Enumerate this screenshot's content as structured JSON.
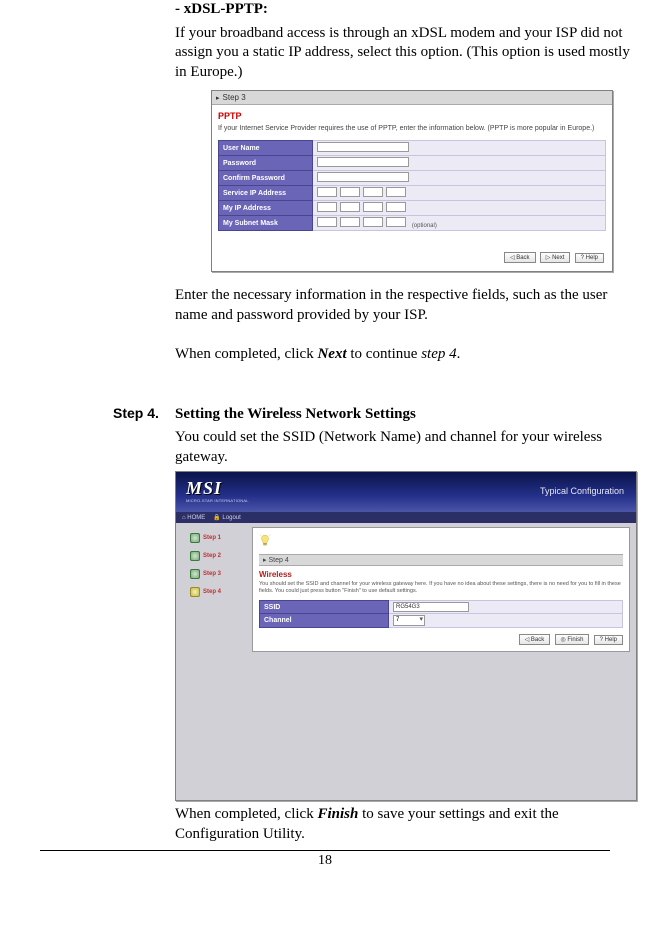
{
  "section1": {
    "title": "- xDSL-PPTP:",
    "desc1": "If your broadband access is through an xDSL modem and your ISP did not assign you a static IP address, select this option. (This option is used mostly in Europe.)",
    "desc2": "Enter the necessary information in the respective fields, such as the user name and password provided by your ISP.",
    "desc3a": "When completed, click ",
    "desc3b": "Next",
    "desc3c": " to continue ",
    "desc3d": "step 4",
    "desc3e": "."
  },
  "shot1": {
    "stepbar": "Step 3",
    "title": "PPTP",
    "desc": "If your Internet Service Provider requires the use of PPTP, enter the information below. (PPTP is more popular in Europe.)",
    "rows": {
      "r1": "User Name",
      "r2": "Password",
      "r3": "Confirm Password",
      "r4": "Service IP Address",
      "r5": "My IP Address",
      "r6": "My Subnet Mask"
    },
    "optional": "(optional)",
    "btns": {
      "back": "◁ Back",
      "next": "▷ Next",
      "help": "? Help"
    }
  },
  "step4": {
    "label": "Step 4.",
    "heading": "Setting the Wireless Network Settings",
    "body": "You could set the SSID (Network Name) and channel for your wireless gateway.",
    "closing_a": "When completed, click ",
    "closing_b": "Finish",
    "closing_c": " to save your settings and exit the Configuration Utility."
  },
  "shot2": {
    "logo": "MSI",
    "logosub": "MICRO-STAR INTERNATIONAL",
    "typconf": "Typical Configuration",
    "home": "⌂ HOME",
    "logout": "🔒 Logout",
    "steps": {
      "s1": "Step 1",
      "s2": "Step 2",
      "s3": "Step 3",
      "s4": "Step 4"
    },
    "stepflag": "Step 4",
    "wlbl": "Wireless",
    "wdesc": "You should set the SSID and channel for your wireless gateway here. If you have no idea about these settings, there is no need for you to fill in these fields. You could just press button \"Finish\" to use default settings.",
    "ssid_label": "SSID",
    "ssid_value": "RG54G3",
    "channel_label": "Channel",
    "channel_value": "7",
    "btns": {
      "back": "◁ Back",
      "finish": "◎ Finish",
      "help": "? Help"
    }
  },
  "page_number": "18"
}
